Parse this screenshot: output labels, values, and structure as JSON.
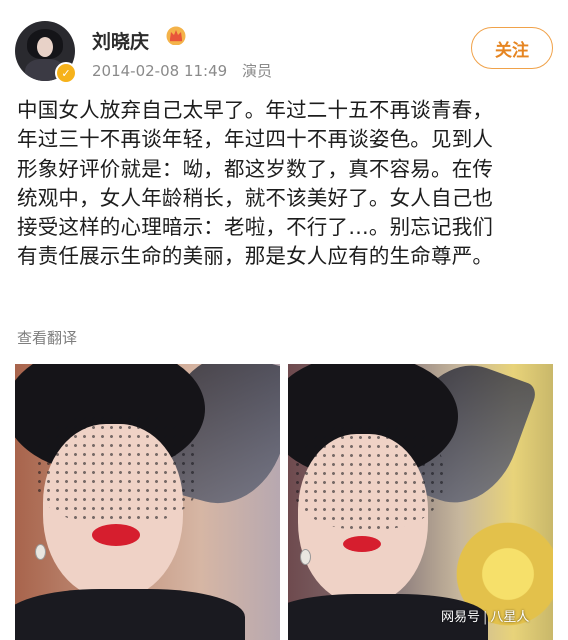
{
  "post": {
    "author": {
      "name": "刘晓庆",
      "crown_icon": "crown-icon",
      "badge_icon": "verified-badge-icon",
      "badge_color": "#f6b21b"
    },
    "meta": {
      "date": "2014-02-08 11:49",
      "role": "演员"
    },
    "follow_label": "关注",
    "body_lines": [
      "中国女人放弃自己太早了。年过二十五不再谈青春，",
      "年过三十不再谈年轻，年过四十不再谈姿色。见到人",
      "形象好评价就是：呦，都这岁数了，真不容易。在传",
      "统观中，女人年龄稍长，就不该美好了。女人自己也",
      "接受这样的心理暗示：老啦，不行了…。别忘记我们",
      "有责任展示生命的美丽，那是女人应有的生命尊严。"
    ],
    "translate_label": "查看翻译"
  },
  "images": [
    {
      "name": "photo-woman-veil-1"
    },
    {
      "name": "photo-woman-veil-2"
    }
  ],
  "watermark": {
    "source": "网易号",
    "channel": "八星人"
  },
  "colors": {
    "accent": "#e68521",
    "follow_border": "#f0a24a",
    "meta_text": "#8a8a8a"
  }
}
